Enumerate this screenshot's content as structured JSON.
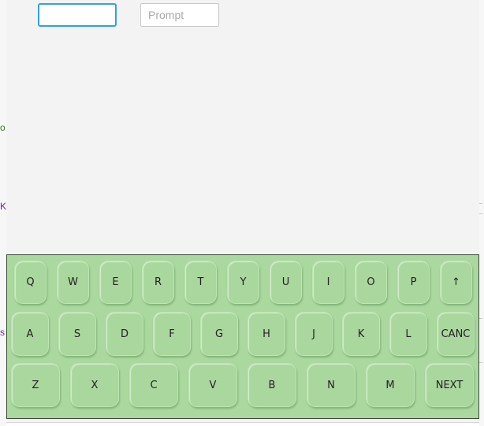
{
  "form": {
    "input1": {
      "value": "",
      "placeholder": ""
    },
    "input2": {
      "value": "",
      "placeholder": "Prompt"
    }
  },
  "background": {
    "edge_chars": [
      "o",
      "K",
      "s"
    ]
  },
  "keyboard": {
    "color": "#aad89e",
    "row1": [
      "Q",
      "W",
      "E",
      "R",
      "T",
      "Y",
      "U",
      "I",
      "O",
      "P",
      "↑"
    ],
    "row2": [
      "A",
      "S",
      "D",
      "F",
      "G",
      "H",
      "J",
      "K",
      "L",
      "CANC"
    ],
    "row3": [
      "Z",
      "X",
      "C",
      "V",
      "B",
      "N",
      "M",
      "NEXT"
    ]
  }
}
